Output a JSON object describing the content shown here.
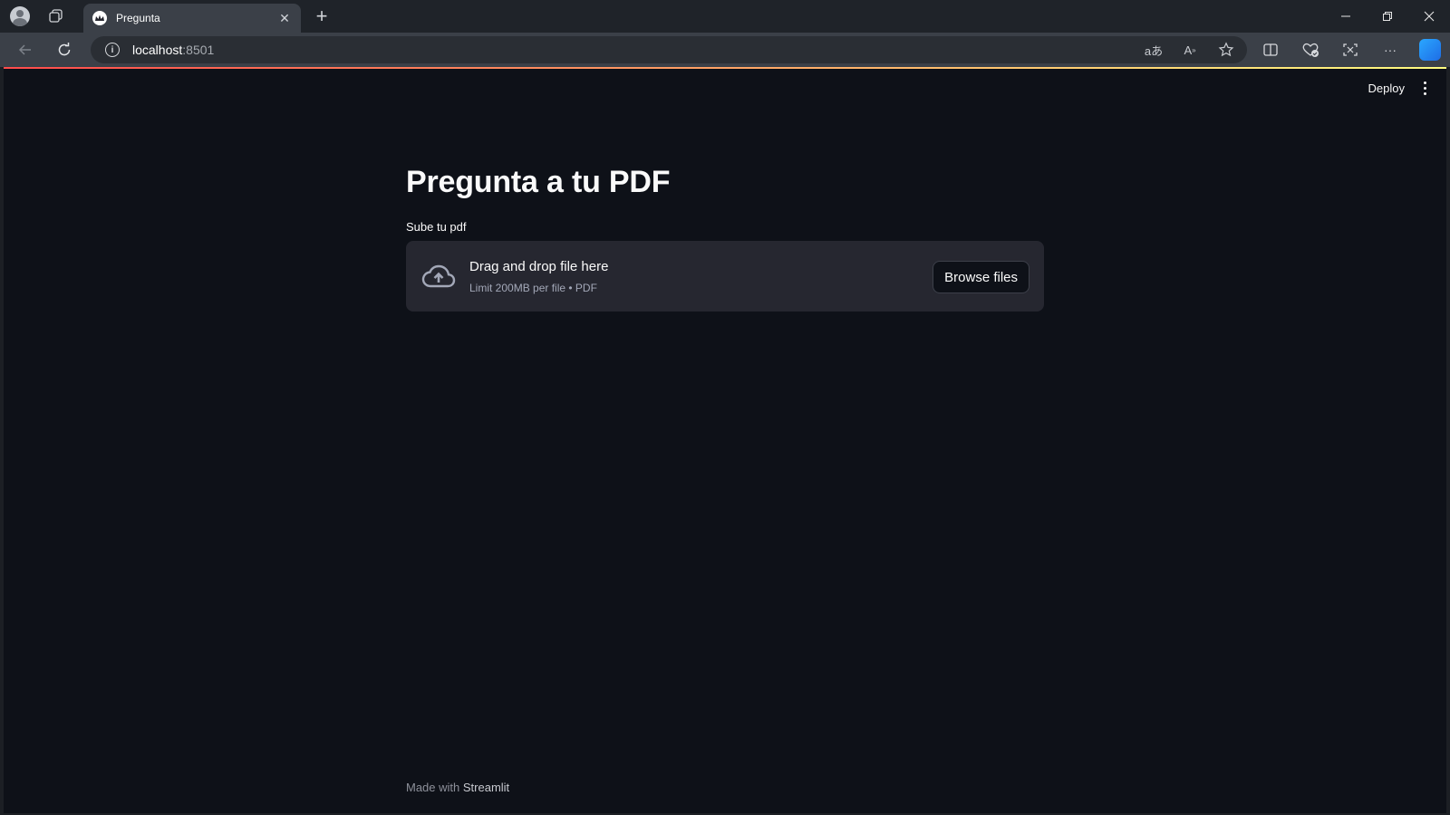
{
  "browser": {
    "tab_title": "Pregunta",
    "url_host": "localhost",
    "url_port": ":8501",
    "icons": [
      "profile-icon",
      "workspaces-icon",
      "close-icon",
      "new-tab-icon",
      "minimize-icon",
      "restore-icon",
      "window-close-icon",
      "back-icon",
      "reload-icon",
      "info-icon",
      "translate-icon",
      "read-aloud-icon",
      "favorite-icon",
      "split-screen-icon",
      "browser-essentials-icon",
      "screenshot-icon",
      "more-icon",
      "copilot-icon"
    ]
  },
  "header": {
    "deploy_label": "Deploy"
  },
  "main": {
    "title": "Pregunta a tu PDF",
    "uploader": {
      "label": "Sube tu pdf",
      "drag_text": "Drag and drop file here",
      "limit_text": "Limit 200MB per file • PDF",
      "browse_label": "Browse files"
    }
  },
  "footer": {
    "made_with": "Made with",
    "brand": "Streamlit"
  },
  "colors": {
    "background": "#0e1118",
    "dropzone": "#262730",
    "text": "#fafafa",
    "accent_start": "#ff4b4b",
    "accent_end": "#fffd80"
  }
}
